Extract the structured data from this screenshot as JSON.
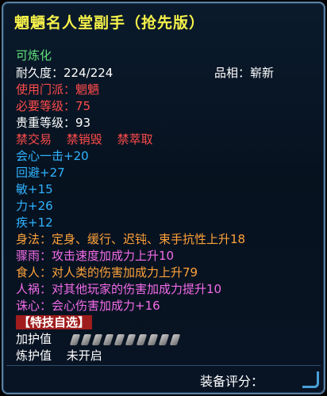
{
  "item": {
    "title": "魍魉名人堂副手（抢先版）",
    "refinable": "可炼化",
    "durability_label": "耐久度：",
    "durability_value": "224/224",
    "grade_label": "品相：",
    "grade_value": "崭新",
    "school_req": "使用门派：魍魉",
    "level_req": "必要等级：75",
    "value_level": "贵重等级：93",
    "restrictions": [
      "禁交易",
      "禁销毁",
      "禁萃取"
    ],
    "base_stats": [
      "会心一击+20",
      "回避+27",
      "敏+15",
      "力+26",
      "疾+12"
    ],
    "effects": [
      {
        "text": "身法：定身、缓行、迟钝、束手抗性上升18",
        "color": "#ffa23a"
      },
      {
        "text": "骤雨：攻击速度加成力上升10",
        "color": "#f36be8"
      },
      {
        "text": "食人：对人类的伤害加成力上升79",
        "color": "#ffa23a"
      },
      {
        "text": "人祸：对其他玩家的伤害加成力提升10",
        "color": "#f36be8"
      },
      {
        "text": "诛心：会心伤害加成力+16",
        "color": "#f36be8"
      }
    ],
    "stunt_title": "【特技自选】",
    "protect_label": "加护值",
    "refine_label": "炼护值",
    "refine_value": "未开启",
    "score_label": "装备评分："
  },
  "colors": {
    "title": "#f6f24a",
    "refinable": "#5fe27a",
    "requirement": "#ff4b4b",
    "stat": "#2fb3ff"
  }
}
